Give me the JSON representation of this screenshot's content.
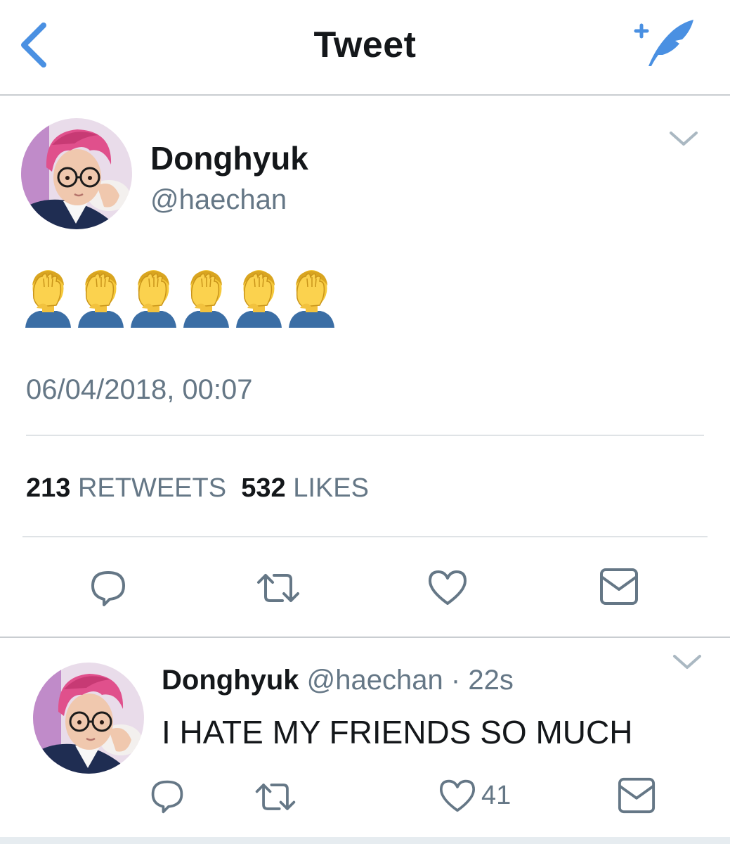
{
  "header": {
    "title": "Tweet",
    "back_icon": "chevron-left-icon",
    "compose_icon": "compose-quill-icon",
    "accent": "#4a90e2"
  },
  "tweet": {
    "author_name": "Donghyuk",
    "author_handle": "@haechan",
    "content_emoji": "🤦‍♂️🤦‍♂️🤦‍♂️🤦‍♂️🤦‍♂️🤦‍♂️",
    "emoji_icon": "man-facepalming-emoji",
    "timestamp": "06/04/2018, 00:07",
    "retweets_count": "213",
    "retweets_label": "RETWEETS",
    "likes_count": "532",
    "likes_label": "LIKES",
    "actions": [
      "reply-icon",
      "retweet-icon",
      "like-icon",
      "direct-message-icon"
    ]
  },
  "reply": {
    "author_name": "Donghyuk",
    "author_handle": "@haechan",
    "separator": "·",
    "time": "22s",
    "text": "I HATE MY FRIENDS SO MUCH",
    "like_count": "41",
    "actions": [
      "reply-icon",
      "retweet-icon",
      "like-icon",
      "direct-message-icon"
    ]
  },
  "colors": {
    "text_primary": "#14171a",
    "text_secondary": "#657786",
    "icon_gray": "#657786",
    "divider": "#dfe3e6",
    "avatar_hair": "#e0508c"
  }
}
